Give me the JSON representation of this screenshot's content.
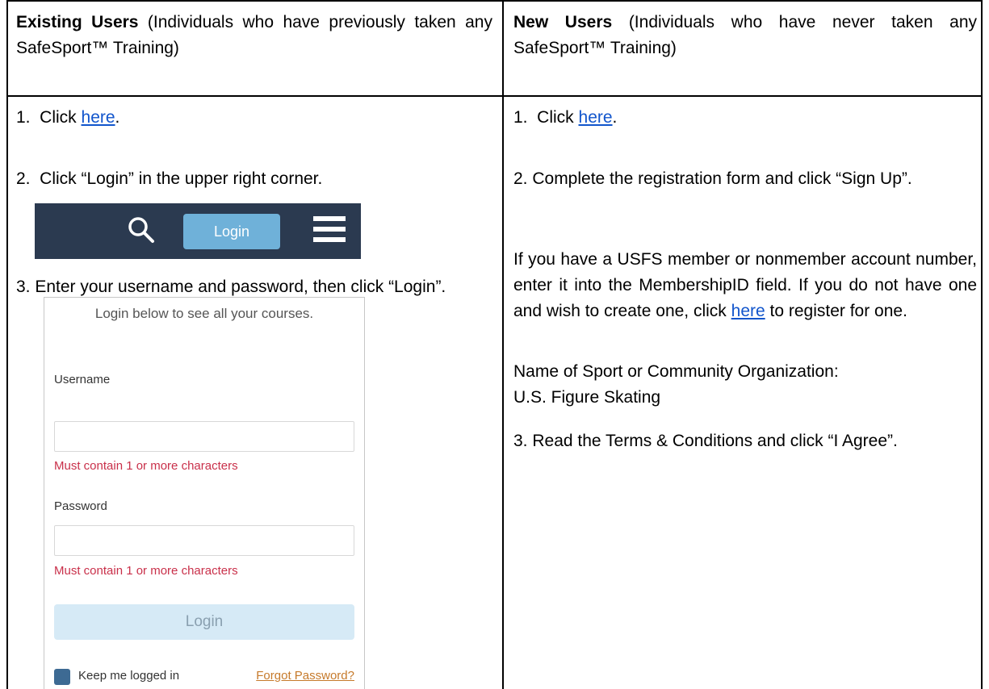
{
  "existing": {
    "heading_bold": "Existing Users",
    "heading_rest": " (Individuals who have previously taken any SafeSport™ Training)",
    "step1_prefix": "1.  Click ",
    "step1_link": "here",
    "step1_suffix": ".",
    "step2": "2.  Click “Login” in the upper right corner.",
    "step3": "3. Enter your username and password, then click “Login”."
  },
  "new_users": {
    "heading_bold": "New Users",
    "heading_rest": " (Individuals who have never taken any SafeSport™ Training)",
    "step1_prefix": "1.  Click ",
    "step1_link": "here",
    "step1_suffix": ".",
    "step2": "2.  Complete the registration form and click “Sign Up”.",
    "para_before_link": "If you have a USFS member or nonmember account number, enter it into the MembershipID field. If you do not have one and wish to create one, click ",
    "para_link": "here",
    "para_after_link": " to register for one.",
    "org_label": "Name of Sport or Community Organization:",
    "org_value": "U.S. Figure Skating",
    "step3": "3. Read the Terms & Conditions and click “I Agree”."
  },
  "login_bar": {
    "login_label": "Login",
    "bg_color": "#2b3a50",
    "button_color": "#6fb1d9"
  },
  "login_form": {
    "heading": "Login below to see all your courses.",
    "username_label": "Username",
    "username_error": "Must contain 1 or more characters",
    "password_label": "Password",
    "password_error": "Must contain 1 or more characters",
    "login_button": "Login",
    "keep_logged_in": "Keep me logged in",
    "forgot_password": "Forgot Password?"
  }
}
